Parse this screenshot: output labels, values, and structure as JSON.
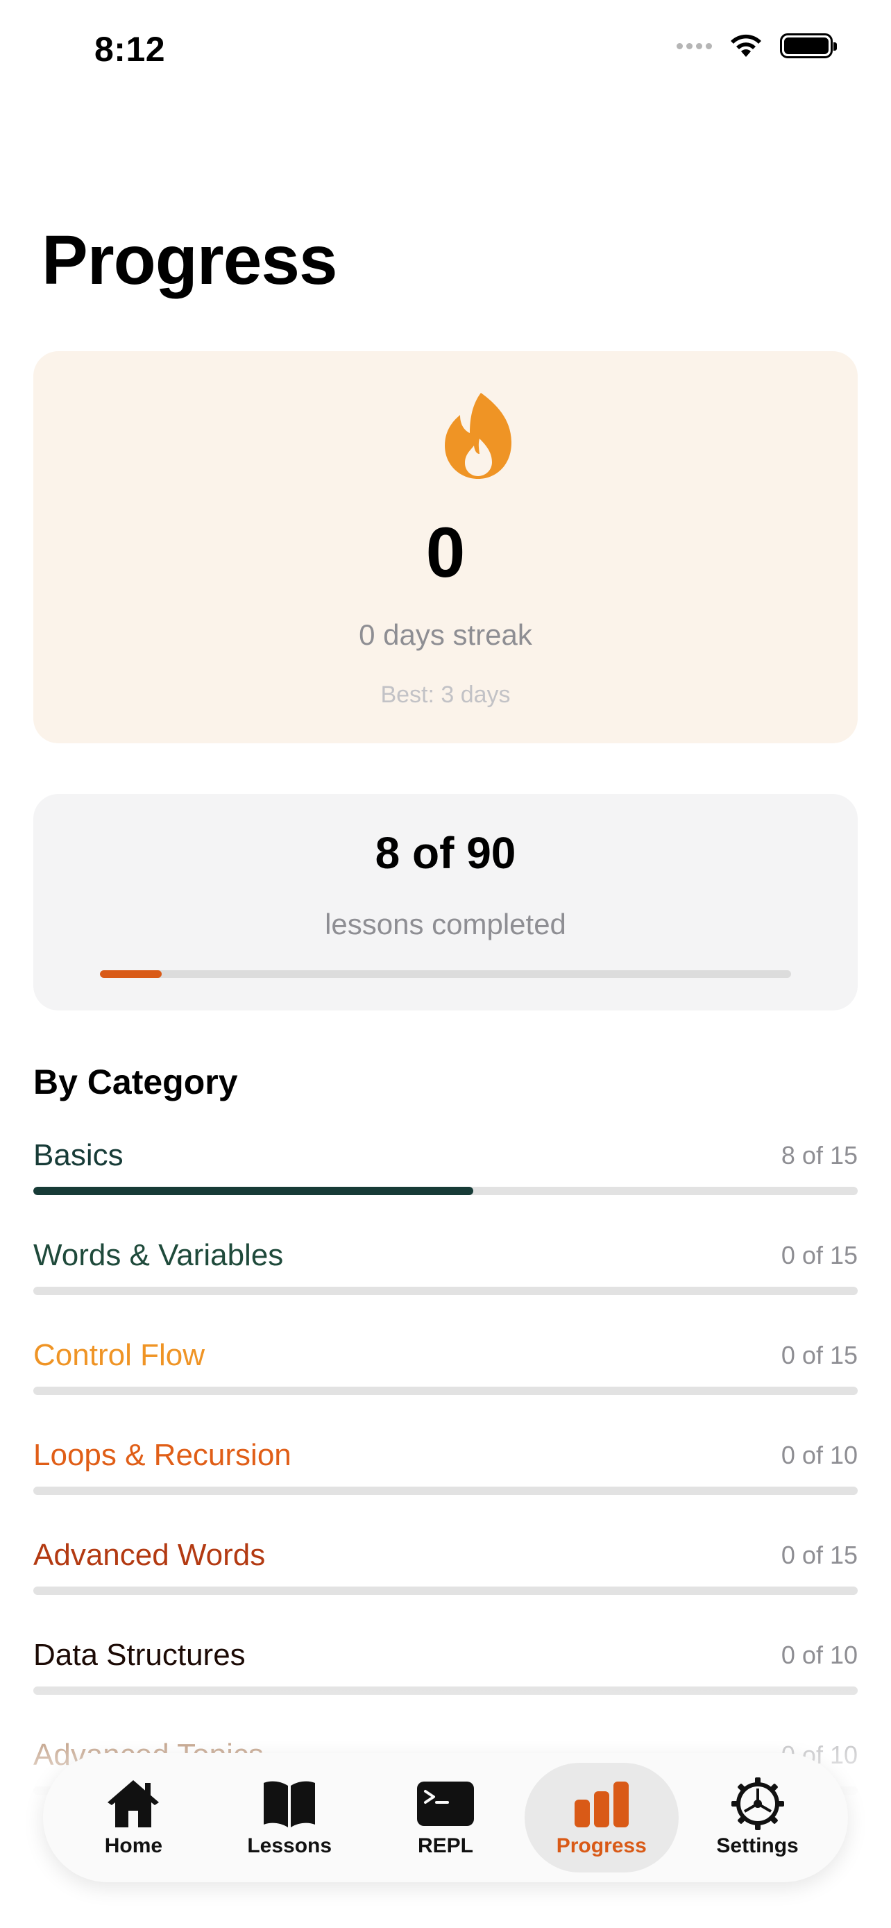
{
  "status_bar": {
    "time": "8:12",
    "icons": [
      "signal-icon",
      "wifi-icon",
      "battery-icon"
    ]
  },
  "page": {
    "title": "Progress"
  },
  "streak": {
    "icon": "flame-icon",
    "count": "0",
    "label": "0 days streak",
    "best": "Best: 3 days",
    "colors": {
      "card_bg": "#fbf3ea",
      "flame": "#ef9425"
    }
  },
  "lessons": {
    "count": "8 of 90",
    "label": "lessons completed",
    "completed": 8,
    "total": 90,
    "accent": "#d95a17"
  },
  "category": {
    "title": "By Category",
    "items": [
      {
        "name": "Basics",
        "count": "8 of 15",
        "completed": 8,
        "total": 15,
        "color": "#173b37"
      },
      {
        "name": "Words & Variables",
        "count": "0 of 15",
        "completed": 0,
        "total": 15,
        "color": "#1f4a3b"
      },
      {
        "name": "Control Flow",
        "count": "0 of 15",
        "completed": 0,
        "total": 15,
        "color": "#ef9425"
      },
      {
        "name": "Loops & Recursion",
        "count": "0 of 10",
        "completed": 0,
        "total": 10,
        "color": "#e05e17"
      },
      {
        "name": "Advanced Words",
        "count": "0 of 15",
        "completed": 0,
        "total": 15,
        "color": "#b33a12"
      },
      {
        "name": "Data Structures",
        "count": "0 of 10",
        "completed": 0,
        "total": 10,
        "color": "#1c0a05"
      },
      {
        "name": "Advanced Topics",
        "count": "0 of 10",
        "completed": 0,
        "total": 10,
        "color": "#8a4a1a"
      }
    ]
  },
  "tab_bar": {
    "tabs": [
      {
        "label": "Home",
        "icon": "house-icon",
        "active": false
      },
      {
        "label": "Lessons",
        "icon": "book-icon",
        "active": false
      },
      {
        "label": "REPL",
        "icon": "terminal-icon",
        "active": false
      },
      {
        "label": "Progress",
        "icon": "chart-bar-icon",
        "active": true
      },
      {
        "label": "Settings",
        "icon": "gear-icon",
        "active": false
      }
    ]
  }
}
